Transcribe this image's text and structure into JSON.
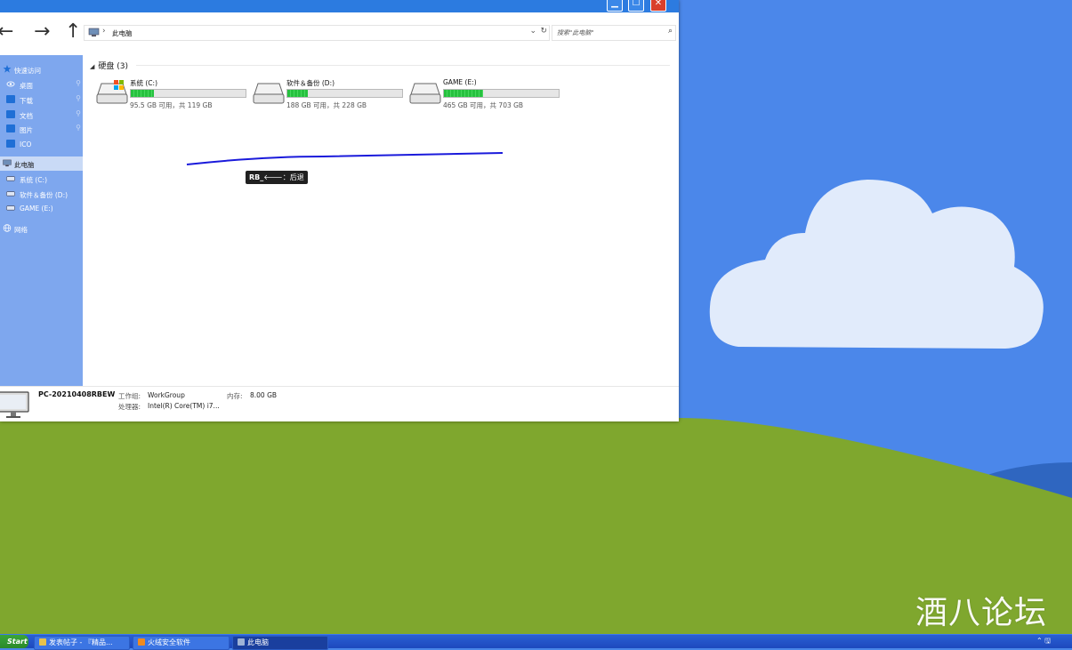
{
  "window": {
    "title_buttons": {
      "minimize": "▁",
      "maximize": "☐",
      "close": "✕"
    }
  },
  "nav": {
    "back": "←",
    "forward": "→",
    "up": "↑"
  },
  "address": {
    "separator": "›",
    "path": "此电脑",
    "dropdown": "⌄",
    "refresh": "↻"
  },
  "search": {
    "placeholder": "搜索\"此电脑\"",
    "icon": "⌕"
  },
  "sidebar": {
    "quick_access": "快速访问",
    "items": [
      {
        "label": "桌面"
      },
      {
        "label": "下载"
      },
      {
        "label": "文档"
      },
      {
        "label": "图片"
      },
      {
        "label": "ICO"
      }
    ],
    "this_pc": "此电脑",
    "drives": [
      {
        "label": "系统 (C:)"
      },
      {
        "label": "软件＆备份 (D:)"
      },
      {
        "label": "GAME (E:)"
      }
    ],
    "network": "网络",
    "pin_icon": "⚲"
  },
  "content": {
    "group_arrow": "◢",
    "group_title": "硬盘 (3)",
    "drives": [
      {
        "name": "系统 (C:)",
        "free_text": "95.5 GB 可用，共 119 GB",
        "used_fraction": 0.2
      },
      {
        "name": "软件＆备份 (D:)",
        "free_text": "188 GB 可用，共 228 GB",
        "used_fraction": 0.18
      },
      {
        "name": "GAME (E:)",
        "free_text": "465 GB 可用，共 703 GB",
        "used_fraction": 0.34
      }
    ]
  },
  "tooltip": {
    "button": "RB_",
    "arrow": "🡐",
    "action": "：后退"
  },
  "details": {
    "pc_name": "PC-20210408RBEW",
    "workgroup_label": "工作组:",
    "workgroup_value": "WorkGroup",
    "memory_label": "内存:",
    "memory_value": "8.00 GB",
    "cpu_label": "处理器:",
    "cpu_value": "Intel(R) Core(TM) i7..."
  },
  "taskbar": {
    "start": "Start",
    "tasks": [
      {
        "label": "发表帖子 - 『精品..."
      },
      {
        "label": "火绒安全软件"
      },
      {
        "label": "此电脑"
      }
    ],
    "tray": "⌃ 🖫"
  },
  "watermark": "酒八论坛",
  "colors": {
    "sky": "#4b87ea",
    "grass": "#7fa72e",
    "sidebar": "#7ea7ee",
    "titlebar": "#2c7be0",
    "drive_bar": "#26c13f",
    "annotation_line": "#1a1adb"
  }
}
